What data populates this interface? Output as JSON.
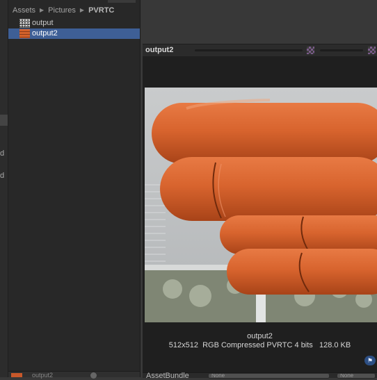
{
  "left_strip": {
    "cut_texts": [
      "d",
      "d"
    ]
  },
  "project": {
    "breadcrumb": [
      "Assets",
      "Pictures",
      "PVRTC"
    ],
    "assets": [
      {
        "label": "output",
        "selected": false
      },
      {
        "label": "output2",
        "selected": true
      }
    ],
    "bottom_label": "output2"
  },
  "preview": {
    "title": "output2",
    "name": "output2",
    "details": "512x512  RGB Compressed PVRTC 4 bits   128.0 KB",
    "tag_icon": "tag-icon"
  },
  "footer": {
    "assetbundle_label": "AssetBundle",
    "dropdown1": "None",
    "dropdown2": "None"
  },
  "colors": {
    "selection": "#3e5f96",
    "panel": "#282828",
    "accent_orange": "#d4622c"
  }
}
